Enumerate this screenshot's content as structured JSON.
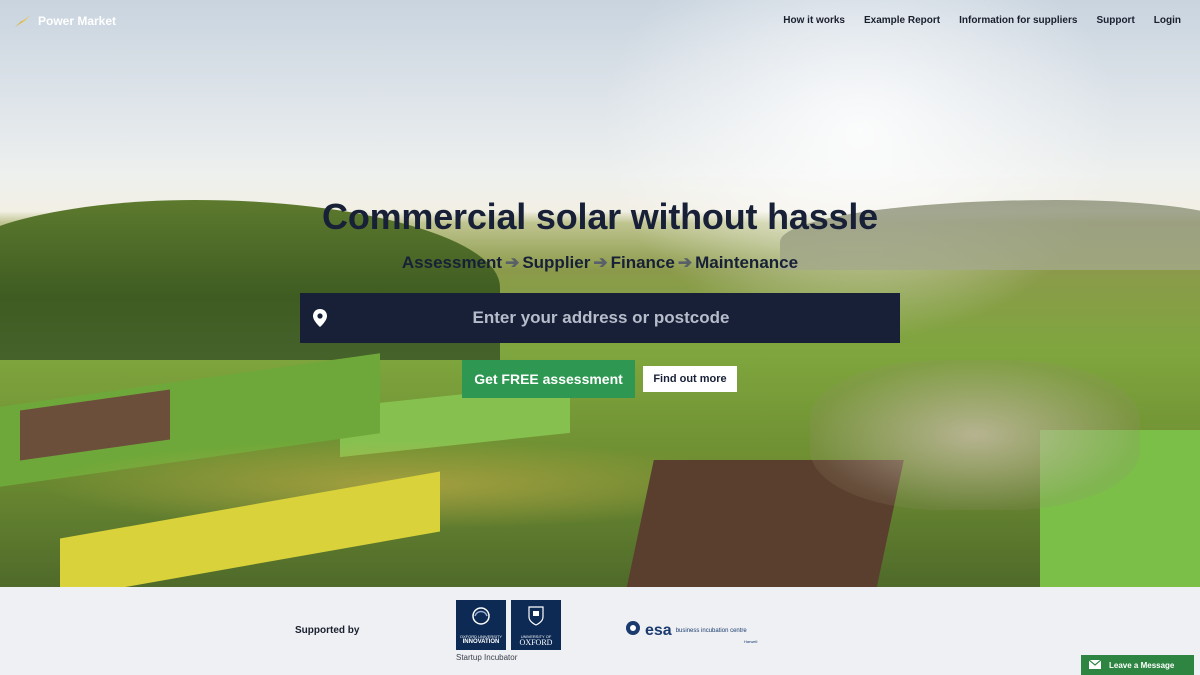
{
  "nav": {
    "brand": "Power Market",
    "links": [
      "How it works",
      "Example Report",
      "Information for suppliers",
      "Support",
      "Login"
    ]
  },
  "hero": {
    "headline": "Commercial solar without hassle",
    "steps": [
      "Assessment",
      "Supplier",
      "Finance",
      "Maintenance"
    ],
    "search_placeholder": "Enter your address or postcode",
    "cta_label": "Get FREE assessment",
    "secondary_label": "Find out more"
  },
  "support": {
    "label": "Supported by",
    "oxford_innovation_small": "OXFORD UNIVERSITY",
    "oxford_innovation_big": "INNOVATION",
    "oxford_uni_small": "UNIVERSITY OF",
    "oxford_uni_big": "OXFORD",
    "incubator_caption": "Startup Incubator",
    "esa_mark": "esa",
    "esa_text": "business incubation centre",
    "esa_sub": "Harwell"
  },
  "message_widget": {
    "label": "Leave a Message"
  },
  "colors": {
    "navy": "#172037",
    "green": "#2e9852",
    "footer_bg": "#eef0f3"
  }
}
